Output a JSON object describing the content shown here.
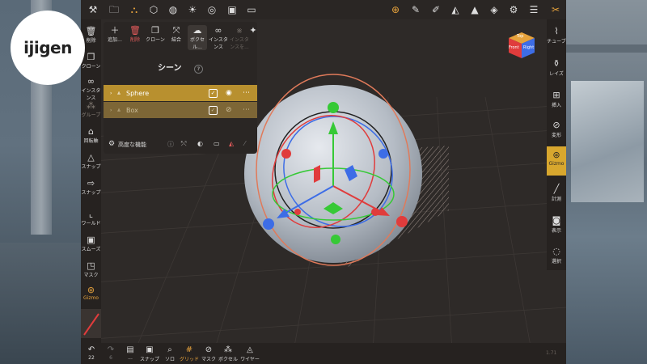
{
  "brand": {
    "logo_text": "ijigen"
  },
  "top_toolbar": {
    "icons": [
      "wrench-icon",
      "folder-icon",
      "scene-graph-icon",
      "shapes-icon",
      "globe-icon",
      "sun-icon",
      "material-icon",
      "image-icon",
      "video-icon",
      "transform-gizmo-icon",
      "pen-icon",
      "brush-icon",
      "triangle-scale-icon",
      "delta-icon",
      "layers-icon",
      "gear-icon",
      "sliders-icon",
      "tools-icon"
    ]
  },
  "left_toolbar": {
    "items": [
      {
        "label": "削除",
        "icon": "trash-icon"
      },
      {
        "label": "クローン",
        "icon": "clone-icon"
      },
      {
        "label": "インスタンス",
        "icon": "link-icon"
      },
      {
        "label": "グループ",
        "icon": "group-icon"
      },
      {
        "label": "回転軸",
        "icon": "lock-icon"
      },
      {
        "label": "スナップ",
        "icon": "triangle-icon"
      },
      {
        "label": "スナップ",
        "icon": "arrow-icon"
      },
      {
        "label": "ワールド",
        "icon": "axes-icon"
      },
      {
        "label": "スムーズ",
        "icon": "smooth-icon"
      },
      {
        "label": "マスク",
        "icon": "mask-icon"
      },
      {
        "label": "Gizmo",
        "icon": "gizmo-icon"
      }
    ]
  },
  "scene_panel": {
    "toolbar": [
      {
        "label": "追加...",
        "icon": "plus-icon"
      },
      {
        "label": "削除",
        "icon": "trash-icon"
      },
      {
        "label": "クローン",
        "icon": "clone-icon"
      },
      {
        "label": "結合",
        "icon": "merge-icon"
      },
      {
        "label": "ボクセル...",
        "icon": "voxel-icon"
      },
      {
        "label": "インスタンス",
        "icon": "link-icon"
      },
      {
        "label": "インスタンスを...",
        "icon": "unlink-icon"
      },
      {
        "label": "",
        "icon": "pin-icon"
      }
    ],
    "title": "シーン",
    "help_icon": "?",
    "objects": [
      {
        "name": "Sphere",
        "checked": "✓",
        "selected": true
      },
      {
        "name": "Box",
        "checked": "✓",
        "selected": false
      }
    ],
    "advanced_label": "高度な機能"
  },
  "right_toolbar": {
    "items": [
      {
        "label": "チューブ",
        "icon": "curve-icon"
      },
      {
        "label": "レイズ",
        "icon": "vase-icon"
      },
      {
        "label": "挿入",
        "icon": "insert-icon"
      },
      {
        "label": "変形",
        "icon": "deform-icon"
      },
      {
        "label": "Gizmo",
        "icon": "gizmo-icon",
        "active": true
      },
      {
        "label": "計測",
        "icon": "ruler-icon"
      },
      {
        "label": "表示",
        "icon": "camera-icon"
      },
      {
        "label": "選択",
        "icon": "select-icon"
      }
    ]
  },
  "bottom_toolbar": {
    "undo_count": "22",
    "redo_count": "6",
    "items": [
      {
        "label": "...",
        "icon": "save-icon"
      },
      {
        "label": "スナップ",
        "icon": "screenshot-icon"
      },
      {
        "label": "ソロ",
        "icon": "magnifier-icon"
      },
      {
        "label": "グリッド",
        "icon": "grid-icon"
      },
      {
        "label": "マスク",
        "icon": "eye-slash-icon"
      },
      {
        "label": "ボクセル",
        "icon": "voxel-icon"
      },
      {
        "label": "ワイヤー",
        "icon": "wire-icon"
      }
    ]
  },
  "view_cube": {
    "top": "Top",
    "front": "Front",
    "right": "Right"
  },
  "version": "1.71",
  "colors": {
    "accent": "#d8a72e",
    "x_axis": "#e03c3c",
    "y_axis": "#36c936",
    "z_axis": "#3d6de6",
    "delete": "#e35b5b"
  }
}
